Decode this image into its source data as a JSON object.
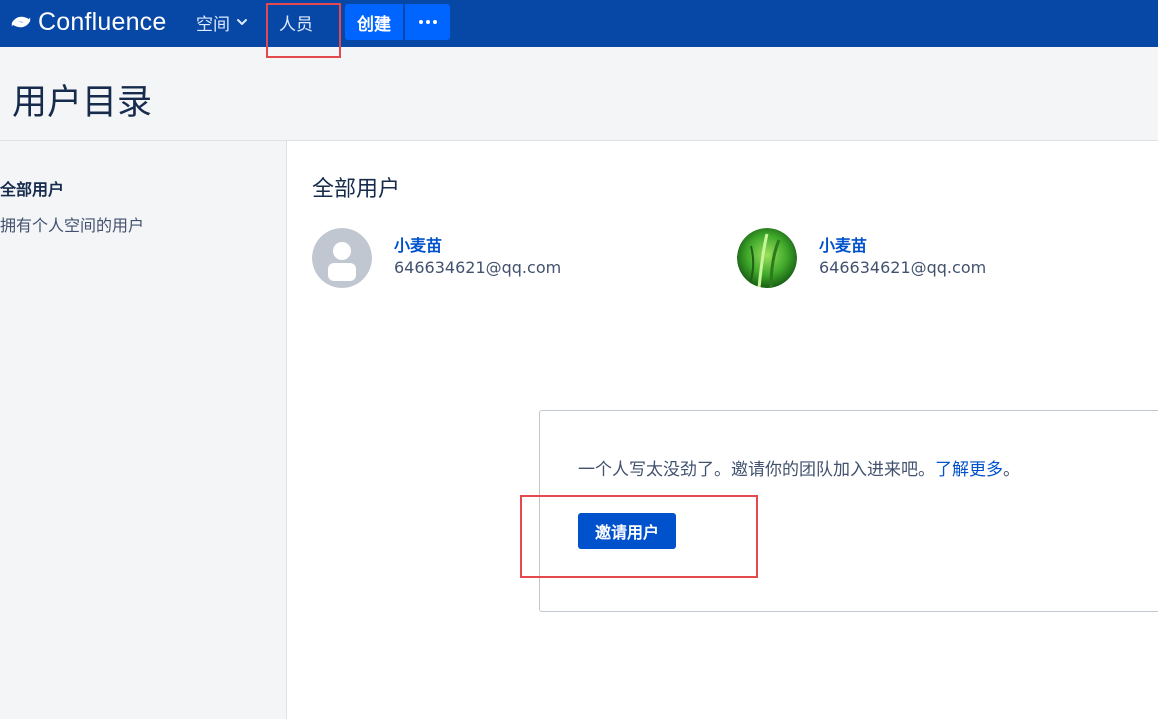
{
  "nav": {
    "logo_text": "Confluence",
    "spaces_label": "空间",
    "people_label": "人员",
    "create_label": "创建"
  },
  "header": {
    "title": "用户目录"
  },
  "sidebar": {
    "items": [
      {
        "label": "全部用户"
      },
      {
        "label": "拥有个人空间的用户"
      }
    ]
  },
  "main": {
    "section_title": "全部用户",
    "users": [
      {
        "name": "小麦苗",
        "email": "646634621@qq.com",
        "avatar": "default-person-icon"
      },
      {
        "name": "小麦苗",
        "email": "646634621@qq.com",
        "avatar": "green-grass-photo"
      }
    ],
    "invite": {
      "message": "一个人写太没劲了。邀请你的团队加入进来吧。",
      "learn_more": "了解更多",
      "suffix": "。",
      "button_label": "邀请用户"
    }
  },
  "colors": {
    "nav_bg": "#0747a6",
    "create_btn": "#0065ff",
    "link": "#0052cc",
    "highlight": "#e5484d"
  }
}
